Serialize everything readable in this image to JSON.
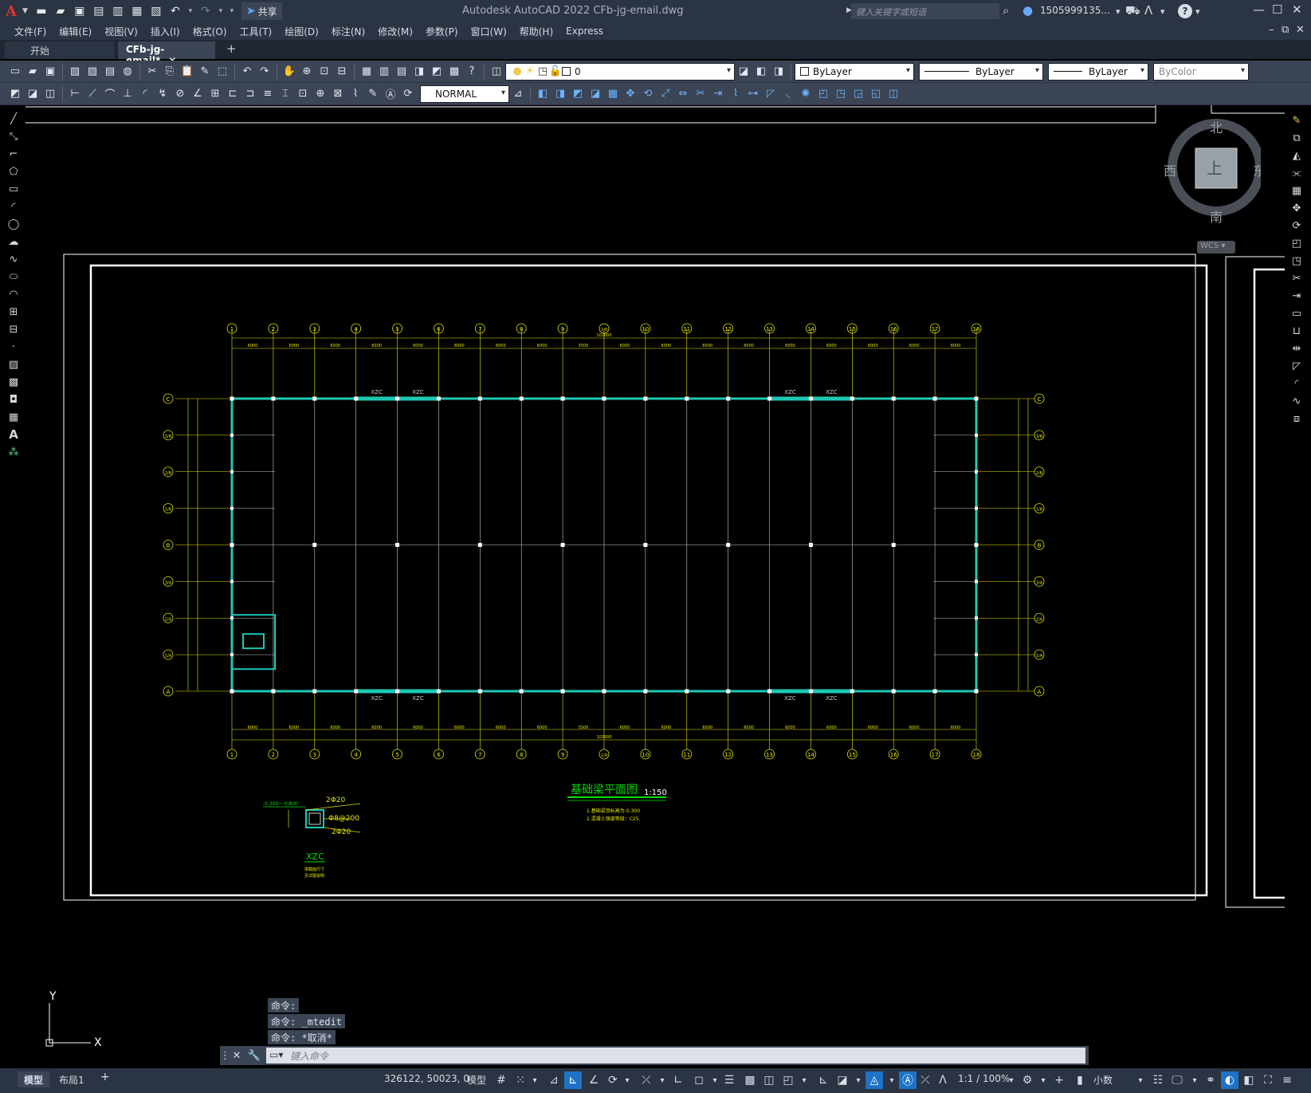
{
  "app": {
    "logo": "A",
    "title": "Autodesk AutoCAD 2022    CFb-jg-email.dwg",
    "share_label": "共享",
    "search_placeholder": "键入关键字或短语",
    "user": "1505999135...",
    "help": "?"
  },
  "menu": [
    "文件(F)",
    "编辑(E)",
    "视图(V)",
    "插入(I)",
    "格式(O)",
    "工具(T)",
    "绘图(D)",
    "标注(N)",
    "修改(M)",
    "参数(P)",
    "窗口(W)",
    "帮助(H)",
    "Express"
  ],
  "tabs": {
    "start": "开始",
    "active": "CFb-jg-email*",
    "close": "✕",
    "add": "+"
  },
  "toolbar": {
    "layer_value": "0",
    "color_value": "ByLayer",
    "linetype_value": "ByLayer",
    "lineweight_value": "ByLayer",
    "plotstyle_value": "ByColor",
    "dimstyle_value": "NORMAL"
  },
  "viewcube": {
    "north": "北",
    "south": "南",
    "east": "东",
    "west": "西",
    "face": "上",
    "wcs": "WCS"
  },
  "drawing": {
    "title": "基础梁平面图",
    "scale": "1:150",
    "note1": "1.基础梁顶标高为-0.300",
    "note2": "2.混凝土强度等级：C25.",
    "axis_top": [
      "1",
      "2",
      "3",
      "4",
      "5",
      "6",
      "7",
      "8",
      "9",
      "1/9",
      "10",
      "11",
      "12",
      "13",
      "14",
      "15",
      "16",
      "17",
      "18"
    ],
    "axis_left": [
      "C",
      "2/B",
      "1/B",
      "B",
      "1/A",
      "A"
    ],
    "axis_left_full": [
      "C",
      "3/B",
      "2/B",
      "1/B",
      "B",
      "3/A",
      "2/A",
      "1/A",
      "A"
    ],
    "dim_text": "6000",
    "dim_5500": "5500",
    "total_dim": "102000",
    "beam_label": "XZC",
    "detail": {
      "label": "XZC",
      "top_bar": "2Φ20",
      "stirrup": "Φ8@200",
      "bottom_bar": "2Φ20",
      "elev": "-0.300~-0.800",
      "note1": "梁截面尺寸",
      "note2": "见详图说明"
    }
  },
  "command": {
    "history": [
      "命令:",
      "命令: _mtedit",
      "命令: *取消*"
    ],
    "placeholder": "键入命令"
  },
  "ucs": {
    "x": "X",
    "y": "Y"
  },
  "status": {
    "layout_model": "模型",
    "layout_1": "布局1",
    "add": "+",
    "coords": "326122, 50023, 0",
    "model": "模型",
    "scale": "1:1 / 100%",
    "units": "小数"
  },
  "colors": {
    "beam": "#1ec8b4",
    "axis": "#e6e600",
    "grid": "#c8c8c8",
    "border": "#ffffff",
    "text_green": "#00e000"
  }
}
